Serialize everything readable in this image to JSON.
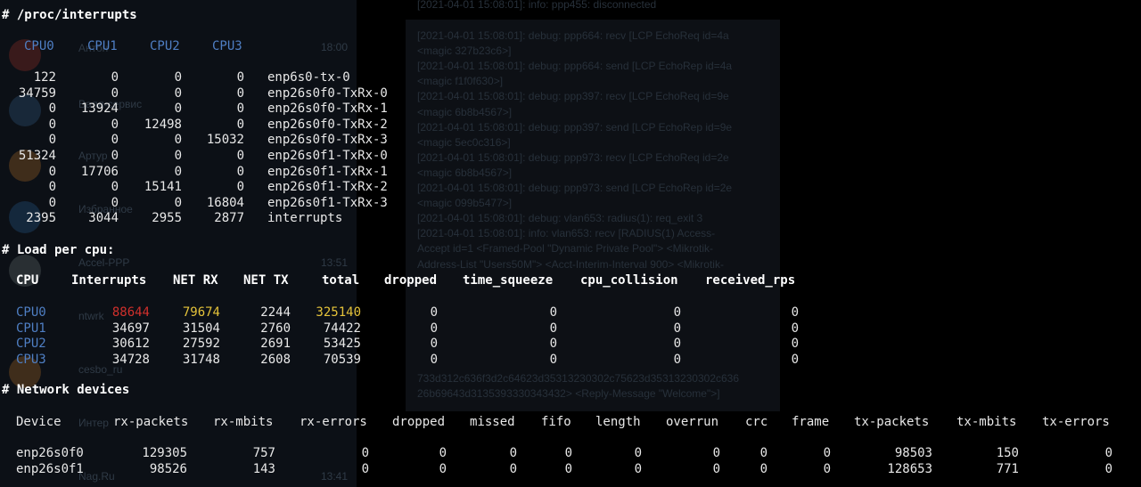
{
  "sections": {
    "interrupts": "# /proc/interrupts",
    "load": "# Load per cpu:",
    "network": "# Network devices"
  },
  "interrupts": {
    "cpu_headers": [
      "CPU0",
      "CPU1",
      "CPU2",
      "CPU3"
    ],
    "rows": [
      [
        "122",
        "0",
        "0",
        "0",
        "enp6s0-tx-0"
      ],
      [
        "34759",
        "0",
        "0",
        "0",
        "enp26s0f0-TxRx-0"
      ],
      [
        "0",
        "13924",
        "0",
        "0",
        "enp26s0f0-TxRx-1"
      ],
      [
        "0",
        "0",
        "12498",
        "0",
        "enp26s0f0-TxRx-2"
      ],
      [
        "0",
        "0",
        "0",
        "15032",
        "enp26s0f0-TxRx-3"
      ],
      [
        "51324",
        "0",
        "0",
        "0",
        "enp26s0f1-TxRx-0"
      ],
      [
        "0",
        "17706",
        "0",
        "0",
        "enp26s0f1-TxRx-1"
      ],
      [
        "0",
        "0",
        "15141",
        "0",
        "enp26s0f1-TxRx-2"
      ],
      [
        "0",
        "0",
        "0",
        "16804",
        "enp26s0f1-TxRx-3"
      ],
      [
        "2395",
        "3044",
        "2955",
        "2877",
        "interrupts"
      ]
    ]
  },
  "load": {
    "headers": [
      "CPU",
      "Interrupts",
      "NET RX",
      "NET TX",
      "total",
      "dropped",
      "time_squeeze",
      "cpu_collision",
      "received_rps"
    ],
    "rows": [
      [
        "CPU0",
        "88644",
        "79674",
        "2244",
        "325140",
        "0",
        "0",
        "0",
        "0"
      ],
      [
        "CPU1",
        "34697",
        "31504",
        "2760",
        "74422",
        "0",
        "0",
        "0",
        "0"
      ],
      [
        "CPU2",
        "30612",
        "27592",
        "2691",
        "53425",
        "0",
        "0",
        "0",
        "0"
      ],
      [
        "CPU3",
        "34728",
        "31748",
        "2608",
        "70539",
        "0",
        "0",
        "0",
        "0"
      ]
    ],
    "colors": {
      "cpu": "#4f7fc4",
      "highlight_red": "#d0302c",
      "highlight_yellow": "#e5c33a"
    }
  },
  "network": {
    "headers": [
      "Device",
      "rx-packets",
      "rx-mbits",
      "rx-errors",
      "dropped",
      "missed",
      "fifo",
      "length",
      "overrun",
      "crc",
      "frame",
      "tx-packets",
      "tx-mbits",
      "tx-errors"
    ],
    "rows": [
      [
        "enp26s0f0",
        "129305",
        "757",
        "0",
        "0",
        "0",
        "0",
        "0",
        "0",
        "0",
        "0",
        "98503",
        "150",
        "0"
      ],
      [
        "enp26s0f1",
        "98526",
        "143",
        "0",
        "0",
        "0",
        "0",
        "0",
        "0",
        "0",
        "0",
        "128653",
        "771",
        "0"
      ]
    ]
  },
  "background": {
    "chat_names": [
      "Антон",
      "Валл-сервис",
      "Артур",
      "Избранное",
      "Accel-PPP",
      "ntwrk",
      "cesbo_ru",
      "Интер",
      "Nag.Ru"
    ],
    "chat_times": [
      "18:00",
      "13:51",
      "13:41"
    ],
    "log_lines": [
      "[2021-04-01 15:08:01]: info: ppp455: disconnected",
      "[2021-04-01 15:08:01]: debug: ppp664: recv [LCP EchoReq id=4a",
      "<magic 327b23c6>]",
      "[2021-04-01 15:08:01]: debug: ppp664: send [LCP EchoRep id=4a",
      "<magic f1f0f630>]",
      "[2021-04-01 15:08:01]: debug: ppp397: recv [LCP EchoReq id=9e",
      "<magic 6b8b4567>]",
      "[2021-04-01 15:08:01]: debug: ppp397: send [LCP EchoRep id=9e",
      "<magic 5ec0c316>]",
      "[2021-04-01 15:08:01]: debug: ppp973: recv [LCP EchoReq id=2e",
      "<magic 6b8b4567>]",
      "[2021-04-01 15:08:01]: debug: ppp973: send [LCP EchoRep id=2e",
      "<magic 099b5477>]",
      "[2021-04-01 15:08:01]: debug: vlan653: radius(1): req_exit 3",
      "[2021-04-01 15:08:01]: info: vlan653: recv [RADIUS(1) Access-",
      "Accept id=1 <Framed-Pool \"Dynamic Private Pool\"> <Mikrotik-",
      "Address-List \"Users50M\"> <Acct-Interim-Interval 900> <Mikrotik-",
      "733d312c636f3d2c64623d35313230302c75623d35313230302c636",
      "26b69643d3135393330343432> <Reply-Message \"Welcome\">]"
    ]
  }
}
